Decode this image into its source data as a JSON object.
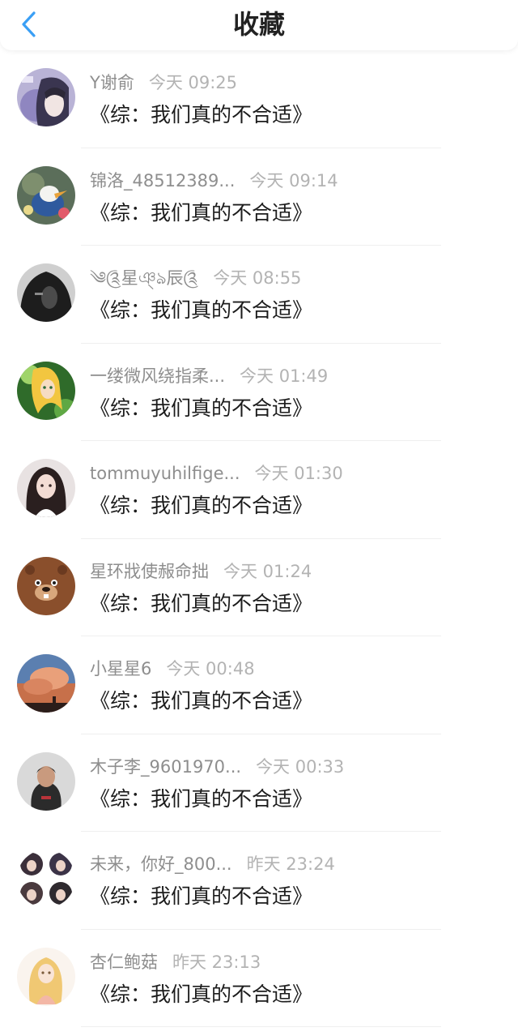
{
  "header": {
    "title": "收藏",
    "back_icon": "chevron-left-icon",
    "accent_color": "#3a9ff5"
  },
  "items": [
    {
      "name": "Y谢俞",
      "time": "今天 09:25",
      "book": "《综：我们真的不合适》",
      "avatar": "anime-boy-avatar"
    },
    {
      "name": "锦洛_48512389...",
      "time": "今天 09:14",
      "book": "《综：我们真的不合适》",
      "avatar": "cartoon-duck-avatar"
    },
    {
      "name": "༄༊星ঞ্ঌ辰༊",
      "time": "今天 08:55",
      "book": "《综：我们真的不合适》",
      "avatar": "dark-hair-avatar"
    },
    {
      "name": "一缕微风绕指柔...",
      "time": "今天 01:49",
      "book": "《综：我们真的不合适》",
      "avatar": "anime-girl-avatar"
    },
    {
      "name": "tommuyuhilfige...",
      "time": "今天 01:30",
      "book": "《综：我们真的不合适》",
      "avatar": "doll-avatar"
    },
    {
      "name": "星环戕使赧命拙",
      "time": "今天 01:24",
      "book": "《综：我们真的不合适》",
      "avatar": "bear-avatar"
    },
    {
      "name": "小星星6",
      "time": "今天 00:48",
      "book": "《综：我们真的不合适》",
      "avatar": "sunset-avatar"
    },
    {
      "name": "木子李_9601970...",
      "time": "今天 00:33",
      "book": "《综：我们真的不合适》",
      "avatar": "photo-avatar"
    },
    {
      "name": "未来，你好_800...",
      "time": "昨天 23:24",
      "book": "《综：我们真的不合适》",
      "avatar": "group-avatar"
    },
    {
      "name": "杏仁鲍菇",
      "time": "昨天 23:13",
      "book": "《综：我们真的不合适》",
      "avatar": "blonde-girl-avatar"
    }
  ]
}
